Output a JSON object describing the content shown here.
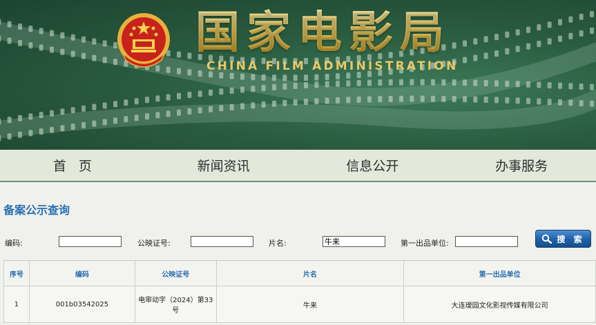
{
  "header": {
    "title_cn": "国家电影局",
    "title_en": "CHINA FILM ADMINISTRATION"
  },
  "nav": {
    "items": [
      {
        "label": "首 页"
      },
      {
        "label": "新闻资讯"
      },
      {
        "label": "信息公开"
      },
      {
        "label": "办事服务"
      }
    ]
  },
  "search": {
    "section_title": "备案公示查询",
    "fields": {
      "code": {
        "label": "编码:",
        "value": ""
      },
      "license": {
        "label": "公映证号:",
        "value": ""
      },
      "film_name": {
        "label": "片名:",
        "value": "牛来"
      },
      "producer": {
        "label": "第一出品单位:",
        "value": ""
      }
    },
    "button_label": "搜 索"
  },
  "results": {
    "columns": [
      "序号",
      "编码",
      "公映证号",
      "片名",
      "第一出品单位"
    ],
    "rows": [
      {
        "index": "1",
        "code": "001b03542025",
        "license": "电审动字（2024）第33号",
        "film": "牛来",
        "producer": "大连瑷园文化影视传媒有限公司"
      }
    ]
  },
  "colors": {
    "banner_green": "#2a5c40",
    "gold": "#f0d16a",
    "link_blue": "#2a6fb3",
    "button_blue": "#1f5fa6"
  }
}
